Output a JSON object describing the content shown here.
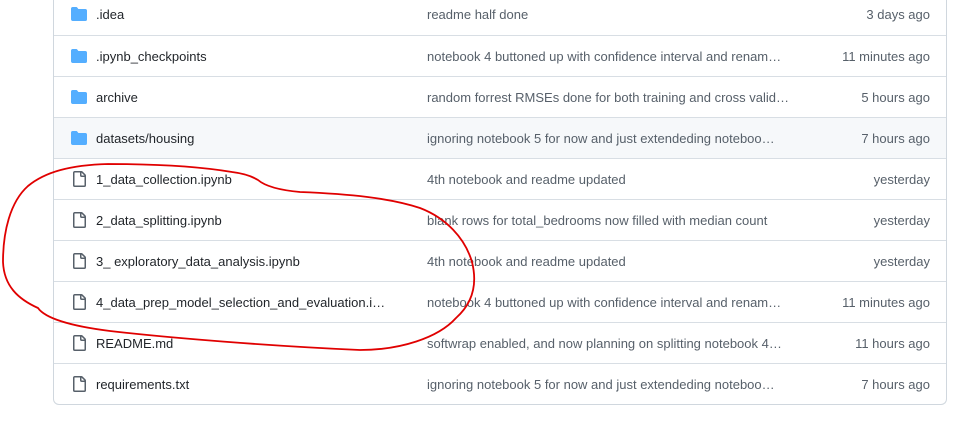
{
  "files": [
    {
      "type": "folder",
      "icon": "folder-icon",
      "name": ".idea",
      "commit": "readme half done",
      "age": "3 days ago"
    },
    {
      "type": "folder",
      "icon": "folder-icon",
      "name": ".ipynb_checkpoints",
      "commit": "notebook 4 buttoned up with confidence interval and renam…",
      "age": "11 minutes ago"
    },
    {
      "type": "folder",
      "icon": "folder-icon",
      "name": "archive",
      "commit": "random forrest RMSEs done for both training and cross valid…",
      "age": "5 hours ago"
    },
    {
      "type": "folder",
      "icon": "folder-icon",
      "name": "datasets/housing",
      "commit": "ignoring notebook 5 for now and just extendeding noteboo…",
      "age": "7 hours ago"
    },
    {
      "type": "file",
      "icon": "file-icon",
      "name": "1_data_collection.ipynb",
      "commit": "4th notebook and readme updated",
      "age": "yesterday"
    },
    {
      "type": "file",
      "icon": "file-icon",
      "name": "2_data_splitting.ipynb",
      "commit": "blank rows for total_bedrooms now filled with median count",
      "age": "yesterday"
    },
    {
      "type": "file",
      "icon": "file-icon",
      "name": "3_ exploratory_data_analysis.ipynb",
      "commit": "4th notebook and readme updated",
      "age": "yesterday"
    },
    {
      "type": "file",
      "icon": "file-icon",
      "name": "4_data_prep_model_selection_and_evaluation.i…",
      "commit": "notebook 4 buttoned up with confidence interval and renam…",
      "age": "11 minutes ago"
    },
    {
      "type": "file",
      "icon": "file-icon",
      "name": "README.md",
      "commit": "softwrap enabled, and now planning on splitting notebook 4…",
      "age": "11 hours ago"
    },
    {
      "type": "file",
      "icon": "file-icon",
      "name": "requirements.txt",
      "commit": "ignoring notebook 5 for now and just extendeding noteboo…",
      "age": "7 hours ago"
    }
  ],
  "colors": {
    "folder": "#54aeff",
    "file_icon": "#57606a",
    "annotation": "#e00000",
    "hover_row": "#f6f8fa"
  }
}
